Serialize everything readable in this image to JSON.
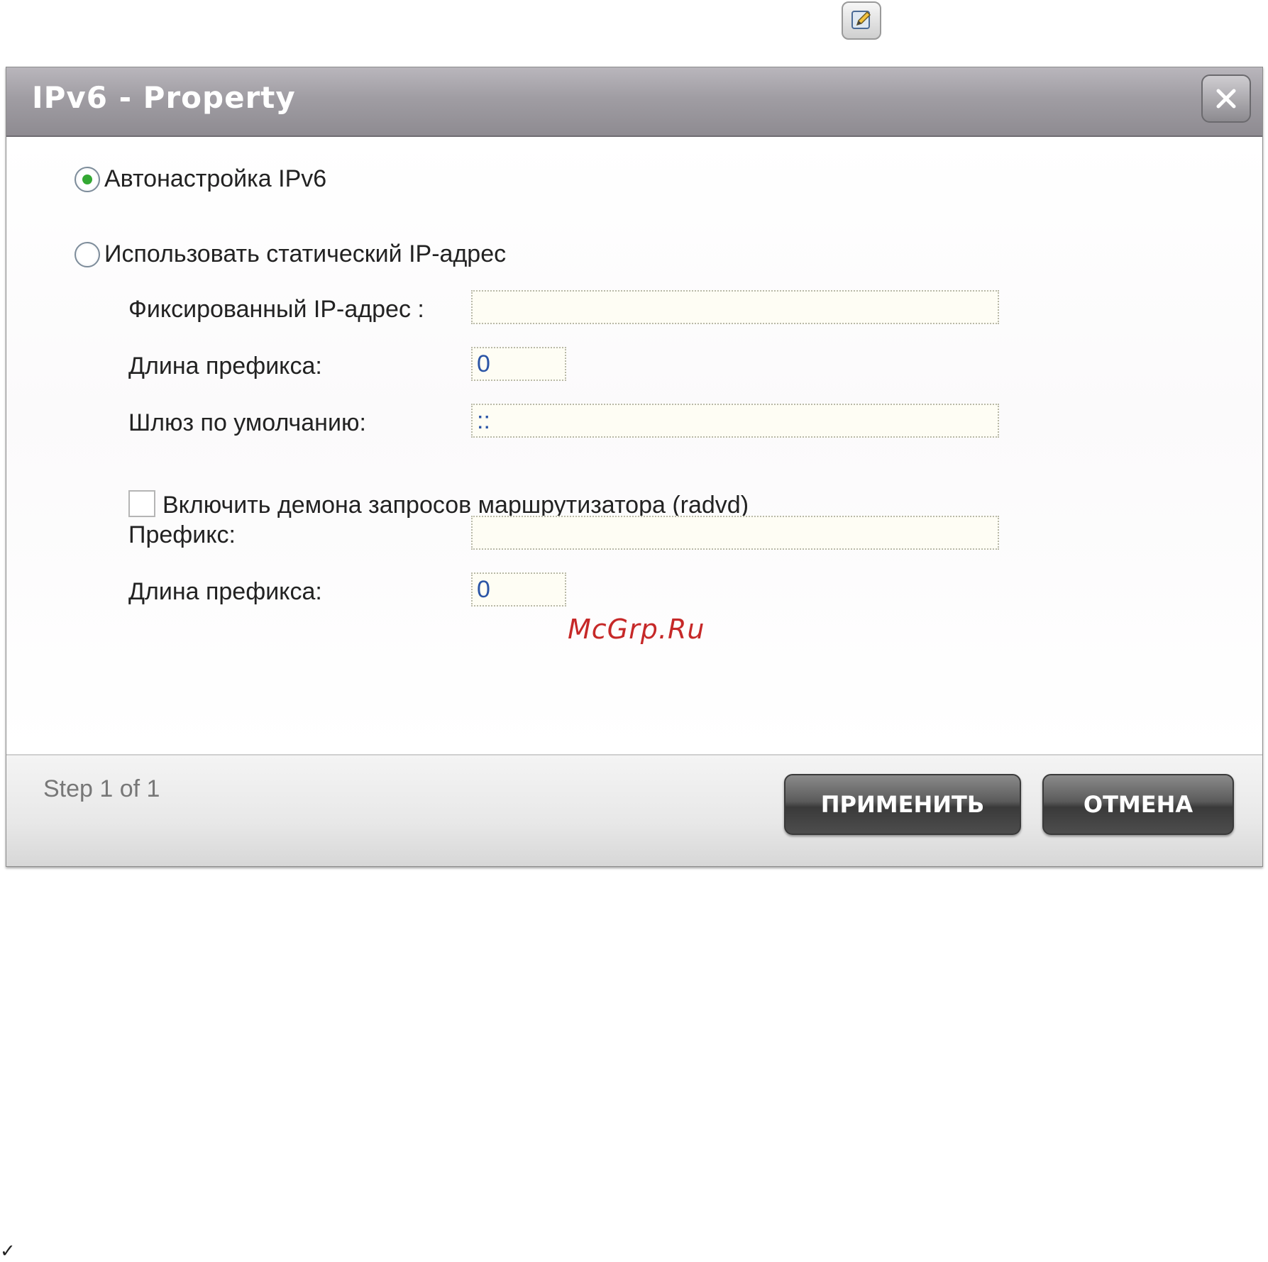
{
  "dialog": {
    "title": "IPv6 - Property",
    "close_label": "X",
    "options": {
      "auto_label": "Автонастройка IPv6",
      "auto_selected": true,
      "static_label": "Использовать статический IP-адрес",
      "static_selected": false
    },
    "fields": {
      "fixed_ip_label": "Фиксированный IP-адрес :",
      "fixed_ip_value": "",
      "prefix_length_label": "Длина префикса:",
      "prefix_length_value": "0",
      "gateway_label": "Шлюз по умолчанию:",
      "gateway_value": "::",
      "radvd_label": "Включить демона запросов маршрутизатора (radvd)",
      "radvd_checked": false,
      "prefix_label": "Префикс:",
      "prefix_value": "",
      "prefix_length2_label": "Длина префикса:",
      "prefix_length2_value": "0"
    },
    "footer": {
      "step_text": "Step 1 of 1",
      "apply_label": "ПРИМЕНИТЬ",
      "cancel_label": "ОТМЕНА"
    }
  },
  "watermark": "McGrp.Ru",
  "checkmark": "✓",
  "colors": {
    "titlebar": "#a09da3",
    "selected_radio": "#33a833",
    "button_dark": "#3a3a3a",
    "watermark": "#c62828"
  }
}
